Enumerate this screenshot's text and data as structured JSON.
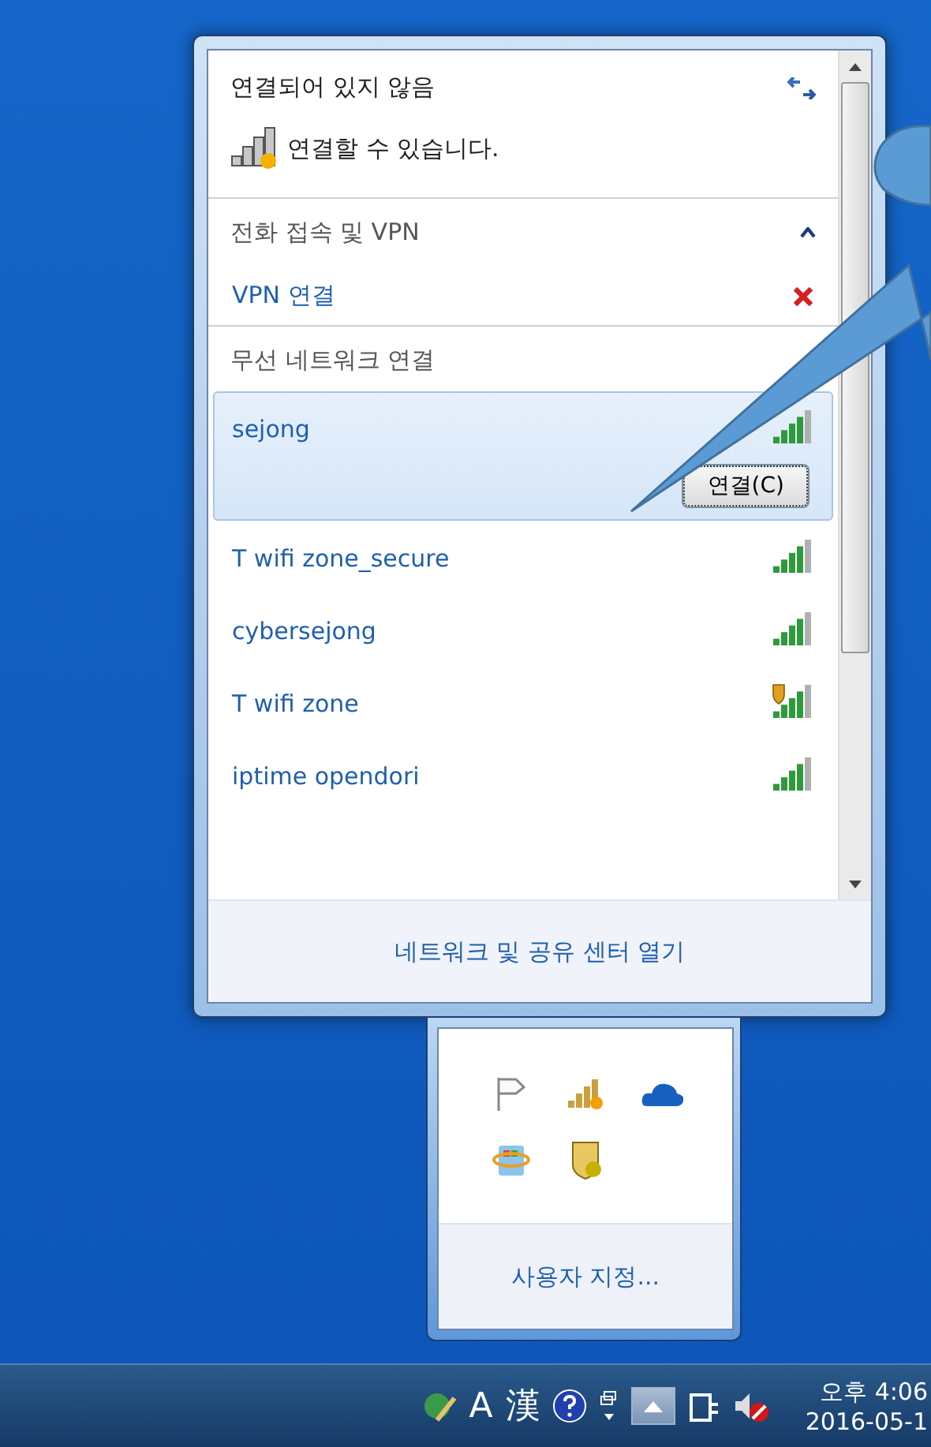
{
  "flyout": {
    "status_title": "연결되어 있지 않음",
    "status_text": "연결할 수 있습니다.",
    "sections": [
      {
        "title": "전화 접속 및 VPN",
        "expanded": true,
        "items": [
          {
            "name": "VPN 연결",
            "kind": "vpn"
          }
        ]
      },
      {
        "title": "무선 네트워크 연결",
        "expanded": true,
        "items": [
          {
            "name": "sejong",
            "kind": "wifi",
            "selected": true,
            "button": "연결(C)"
          },
          {
            "name": "T wifi zone_secure",
            "kind": "wifi",
            "selected": false
          },
          {
            "name": "cybersejong",
            "kind": "wifi",
            "selected": false
          },
          {
            "name": "T wifi zone",
            "kind": "wifi_open",
            "selected": false
          },
          {
            "name": "iptime opendori",
            "kind": "wifi",
            "selected": false
          }
        ]
      }
    ],
    "footer_link": "네트워크 및 공유 센터 열기"
  },
  "tray_overflow": {
    "customize_link": "사용자 지정..."
  },
  "taskbar": {
    "ime_mode": "A",
    "hanja": "漢",
    "time": "오후 4:06",
    "date": "2016-05-1"
  }
}
